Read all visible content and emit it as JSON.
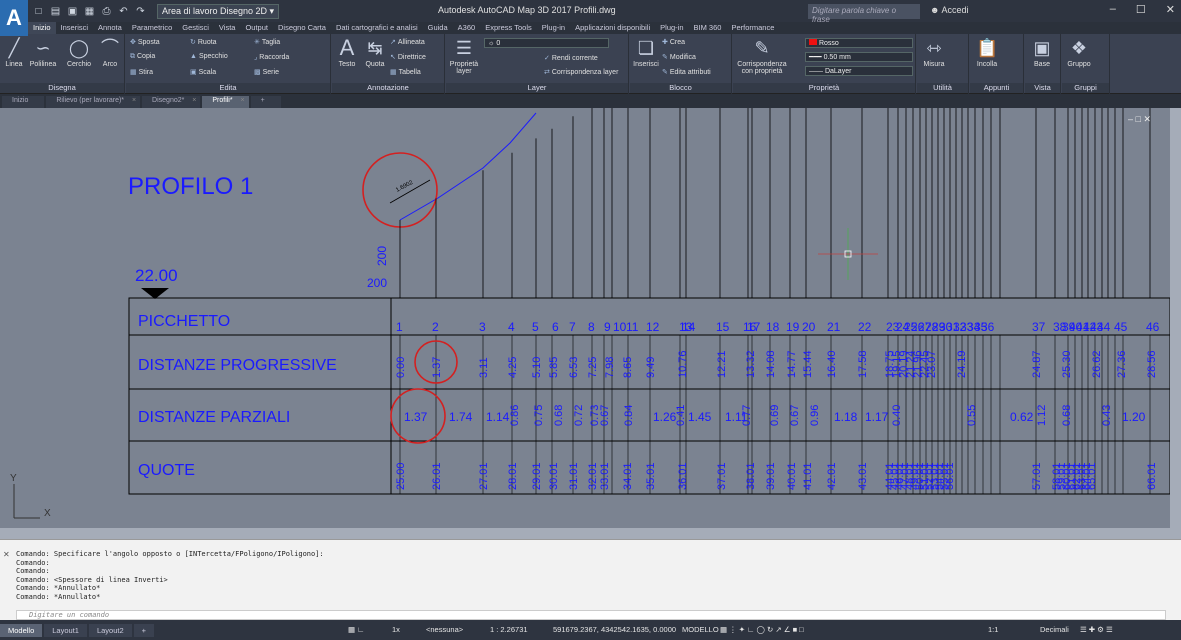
{
  "app": {
    "title": "Autodesk AutoCAD Map 3D 2017    Profili.dwg",
    "logo": "A",
    "workspace": "Area di lavoro Disegno 2D",
    "search_placeholder": "Digitare parola chiave o frase",
    "signin": "Accedi",
    "qat_icons": [
      "new-icon",
      "open-icon",
      "save-icon",
      "saveas-icon",
      "print-icon",
      "undo-icon",
      "redo-icon"
    ]
  },
  "menu_tabs": [
    "Inizio",
    "Inserisci",
    "Annota",
    "Parametrico",
    "Gestisci",
    "Vista",
    "Output",
    "Disegno Carta",
    "Dati cartografici e analisi",
    "Guida",
    "A360",
    "Express Tools",
    "Plug-in",
    "Applicazioni disponibili",
    "Plug-in",
    "BIM 360",
    "Performance"
  ],
  "ribbon": {
    "disegna": {
      "label": "Disegna",
      "linea": "Linea",
      "polilinea": "Polilinea",
      "cerchio": "Cerchio",
      "arco": "Arco"
    },
    "edita": {
      "label": "Edita",
      "sposta": "Sposta",
      "ruota": "Ruota",
      "taglia": "Taglia",
      "copia": "Copia",
      "specchio": "Specchio",
      "raccorda": "Raccorda",
      "stira": "Stira",
      "scala": "Scala",
      "serie": "Serie"
    },
    "annotazione": {
      "label": "Annotazione",
      "testo": "Testo",
      "quota": "Quota",
      "allineata": "Allineata",
      "direttrice": "Direttrice",
      "tabella": "Tabella"
    },
    "layer": {
      "label": "Layer",
      "proprieta": "Proprietà layer",
      "current": "0",
      "rendi": "Rendi corrente",
      "corrisp": "Corrispondenza layer"
    },
    "blocco": {
      "label": "Blocco",
      "inserisci": "Inserisci",
      "crea": "Crea",
      "modifica": "Modifica",
      "edita_attr": "Edita attributi"
    },
    "proprieta": {
      "label": "Proprietà",
      "corrisp": "Corrispondenza con proprietà",
      "color": "Rosso",
      "lineweight": "0.50 mm",
      "linetype": "DaLayer"
    },
    "utilita": {
      "label": "Utilità",
      "misura": "Misura"
    },
    "appunti": {
      "label": "Appunti",
      "incolla": "Incolla"
    },
    "vista": {
      "label": "Vista",
      "base": "Base"
    },
    "gruppi": {
      "label": "Gruppi",
      "gruppo": "Gruppo"
    }
  },
  "doc_tabs": [
    "Inizio",
    "Rilievo (per lavorare)*",
    "Disegno2*",
    "Profili*"
  ],
  "drawing": {
    "title": "PROFILO 1",
    "datum": "22.00",
    "scale_v": "200",
    "scale_h": "200",
    "dimension": "1.6902",
    "rows": [
      "PICCHETTO",
      "DISTANZE PROGRESSIVE",
      "DISTANZE PARZIALI",
      "QUOTE"
    ],
    "picchetti": [
      "1",
      "2",
      "3",
      "4",
      "5",
      "6",
      "7",
      "8",
      "9",
      "10",
      "11",
      "12",
      "13",
      "14",
      "15",
      "16",
      "17",
      "18",
      "19",
      "20",
      "21",
      "22",
      "23",
      "24",
      "25",
      "26",
      "27",
      "28",
      "29",
      "30",
      "31",
      "32",
      "33",
      "34",
      "35",
      "36",
      "37",
      "38",
      "39",
      "40",
      "41",
      "42",
      "43",
      "44",
      "45",
      "46"
    ],
    "progressive": [
      "0.00",
      "1.37",
      "3.11",
      "4.25",
      "5.10",
      "5.85",
      "6.53",
      "7.25",
      "7.98",
      "8.65",
      "9.49",
      "10.76",
      "12.21",
      "13.32",
      "14.08",
      "14.77",
      "15.44",
      "16.40",
      "17.58",
      "18.75",
      "19.15",
      "20.19",
      "21.24",
      "21.96",
      "22.45",
      "23.07",
      "24.19",
      "24.87",
      "25.30",
      "26.62",
      "27.36",
      "28.56"
    ],
    "parziali": [
      "1.37",
      "1.74",
      "1.14",
      "0.86",
      "0.75",
      "0.68",
      "0.72",
      "0.73",
      "0.67",
      "0.84",
      "1.26",
      "0.41",
      "1.45",
      "1.11",
      "0.77",
      "0.69",
      "0.67",
      "0.96",
      "1.18",
      "1.17",
      "0.40",
      "0.55",
      "0.62",
      "1.12",
      "0.68",
      "0.43",
      "1.20"
    ],
    "quote": [
      "25.00",
      "26.01",
      "27.01",
      "28.01",
      "29.01",
      "30.01",
      "31.01",
      "32.01",
      "33.01",
      "34.01",
      "35.01",
      "36.01",
      "37.01",
      "38.01",
      "39.01",
      "40.01",
      "41.01",
      "42.01",
      "43.01",
      "44.01",
      "45.01",
      "46.01",
      "47.01",
      "48.01",
      "49.01",
      "50.01",
      "51.01",
      "52.01",
      "53.01",
      "54.01",
      "55.01",
      "56.01",
      "57.01",
      "58.01",
      "59.01",
      "60.01",
      "61.01",
      "62.01",
      "63.01",
      "64.01",
      "65.01",
      "66.01"
    ],
    "ucs": {
      "x": "X",
      "y": "Y"
    }
  },
  "command": {
    "history": [
      "Comando: Specificare l'angolo opposto o [INTercetta/FPoligono/IPoligono]:",
      "Comando:",
      "Comando:",
      "Comando:  <Spessore di linea Inverti>",
      "Comando: *Annullato*",
      "Comando: *Annullato*"
    ],
    "placeholder": "Digitare un comando"
  },
  "status": {
    "layouts": [
      "Modello",
      "Layout1",
      "Layout2"
    ],
    "coords": "591679.2367, 4342542.1635, 0.0000",
    "mode": "MODELLO",
    "scale": "1 : 2.26731",
    "anno": "<nessuna>",
    "units": "Decimali",
    "snap": "1x",
    "annoscale": "1:1"
  },
  "colors": {
    "drawing_blue": "#1a1aff",
    "markup_red": "#d42020",
    "canvas": "#7b8391"
  }
}
